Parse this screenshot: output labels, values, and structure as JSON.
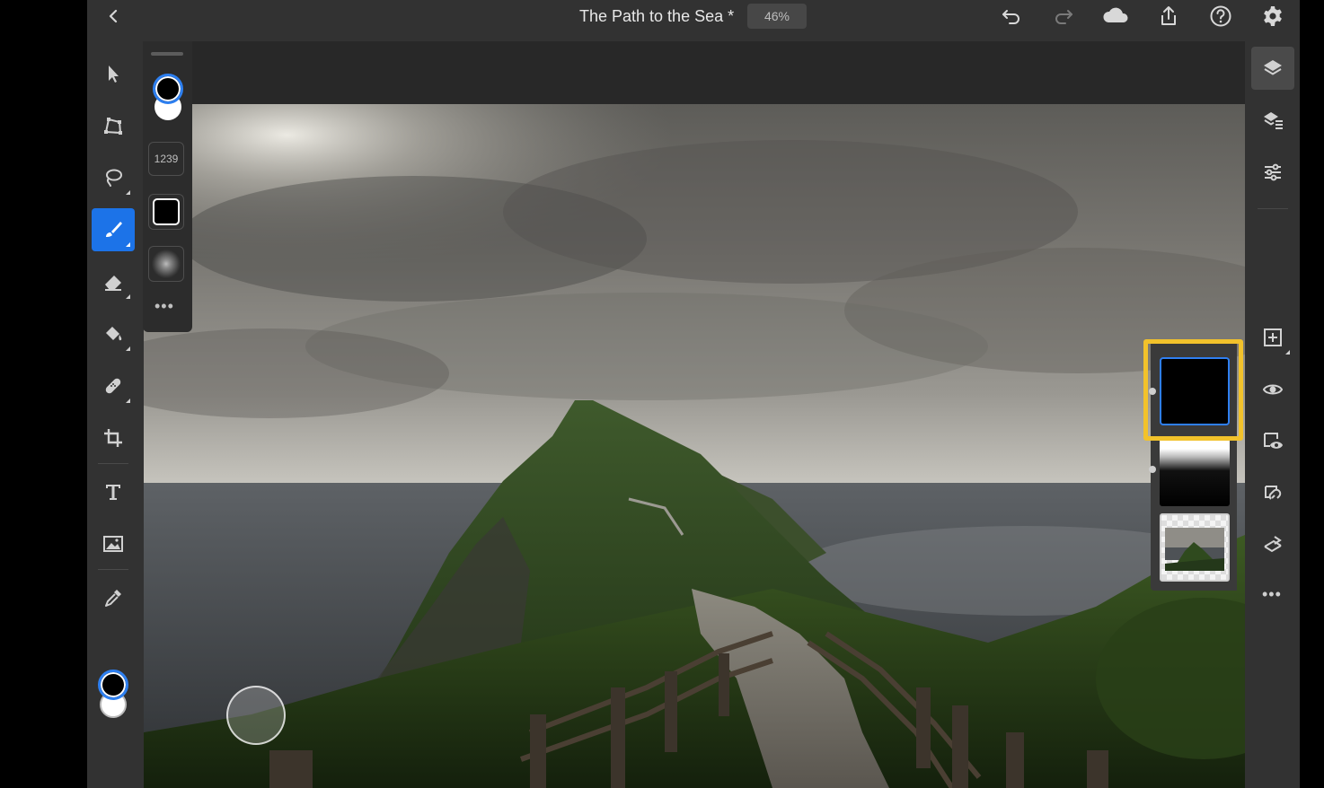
{
  "document": {
    "title": "The Path to the Sea *",
    "zoom": "46%"
  },
  "topbar": {
    "icons": [
      "back-icon",
      "undo-icon",
      "redo-icon",
      "cloud-icon",
      "share-icon",
      "help-icon",
      "settings-icon"
    ]
  },
  "toolbar": {
    "tools": [
      "select-icon",
      "transform-icon",
      "lasso-icon",
      "brush-icon",
      "eraser-icon",
      "fill-icon",
      "healing-icon",
      "crop-icon",
      "type-icon",
      "place-image-icon",
      "eyedropper-icon"
    ],
    "active_tool": "brush-icon",
    "accent_color": "#1c73e8"
  },
  "brush_panel": {
    "size": "1239",
    "foreground_color": "#000000",
    "background_color": "#ffffff",
    "more_label": "•••"
  },
  "rightbar": {
    "icons": [
      "layers-icon",
      "layer-properties-icon",
      "adjustments-icon",
      "add-layer-icon",
      "visibility-icon",
      "mask-icon",
      "clipping-icon",
      "merge-icon"
    ],
    "more_label": "•••"
  },
  "layers": {
    "items": [
      "mask-layer",
      "gradient-mask-layer",
      "photo-layer"
    ],
    "selected": "mask-layer",
    "highlight_color": "#f2c22b"
  }
}
